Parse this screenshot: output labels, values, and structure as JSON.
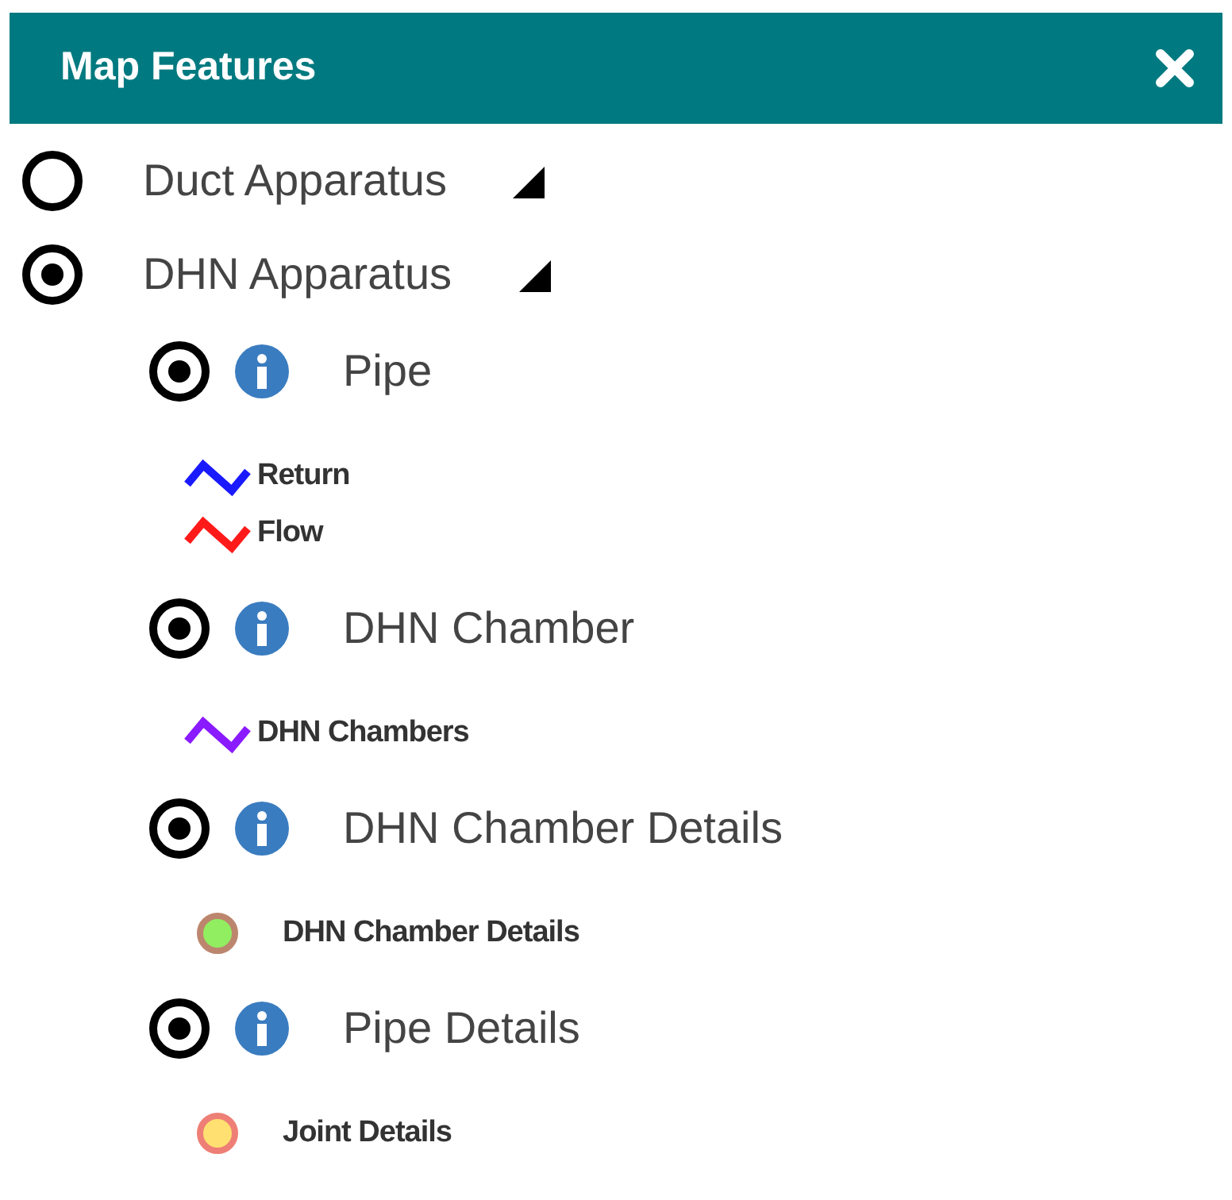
{
  "panel": {
    "title": "Map Features"
  },
  "groups": [
    {
      "label": "Duct Apparatus",
      "selected": false
    },
    {
      "label": "DHN Apparatus",
      "selected": true,
      "layers": [
        {
          "label": "Pipe",
          "checked": true,
          "legend": [
            {
              "kind": "line",
              "label": "Return",
              "color": "#1a1aff"
            },
            {
              "kind": "line",
              "label": "Flow",
              "color": "#ff1a1a"
            }
          ]
        },
        {
          "label": "DHN Chamber",
          "checked": true,
          "legend": [
            {
              "kind": "line",
              "label": "DHN Chambers",
              "color": "#8a1aff"
            }
          ]
        },
        {
          "label": "DHN Chamber Details",
          "checked": true,
          "legend": [
            {
              "kind": "point",
              "label": "DHN Chamber Details",
              "color": "#90ee60"
            }
          ]
        },
        {
          "label": "Pipe Details",
          "checked": true,
          "legend": [
            {
              "kind": "point",
              "label": "Joint Details",
              "color": "#ffe070"
            }
          ]
        }
      ]
    }
  ]
}
